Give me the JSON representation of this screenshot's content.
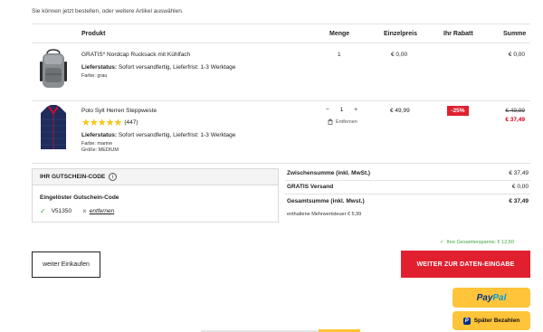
{
  "intro_text": "Sie können jetzt bestellen, oder weitere Artikel auswählen.",
  "table": {
    "headers": {
      "product": "Produkt",
      "quantity": "Menge",
      "unit_price": "Einzelpreis",
      "discount": "Ihr Rabatt",
      "sum": "Summe"
    }
  },
  "items": [
    {
      "name": "GRATIS* Nordcap Rucksack mit Kühlfach",
      "status_label": "Lieferstatus:",
      "status_value": "Sofort versandfertig, Lieferfrist: 1-3 Werktage",
      "color_line": "Farbe: grau",
      "quantity": "1",
      "unit_price": "€ 0,00",
      "sum": "€ 0,00"
    },
    {
      "name": "Polo Sylt Herren Steppweste",
      "rating_count": "(447)",
      "rating_stars": 5,
      "status_label": "Lieferstatus:",
      "status_value": "Sofort versandfertig, Lieferfrist: 1-3 Werktage",
      "color_line": "Farbe: marine",
      "size_line": "Größe: MEDIUM",
      "qty_minus": "−",
      "quantity": "1",
      "qty_plus": "+",
      "remove_label": "Entfernen",
      "unit_price": "€ 49,99",
      "discount": "-25%",
      "old_sum": "€ 49,99",
      "sum": "€ 37,49"
    }
  ],
  "coupon": {
    "header": "IHR GUTSCHEIN-CODE",
    "info_symbol": "i",
    "redeemed_label": "Eingelöster Gutschein-Code",
    "check_symbol": "✓",
    "code": "V51350",
    "remove_symbol": "×",
    "remove_label": "entfernen"
  },
  "totals": {
    "subtotal_label": "Zwischensumme (inkl. MwSt.)",
    "subtotal_value": "€ 37,49",
    "shipping_label": "GRATIS Versand",
    "shipping_value": "€ 0,00",
    "total_label": "Gesamtsumme (inkl. Mwst.)",
    "total_value": "€ 37,49",
    "vat_note": "enthaltene Mehrwertsteuer € 5,99"
  },
  "savings": {
    "check_symbol": "✓",
    "text": "Ihre Gesamtersparnis: € 12,50"
  },
  "buttons": {
    "continue_shopping": "weiter Einkaufen",
    "checkout": "WEITER ZUR DATEN-EINGABE",
    "paypal_part1": "Pay",
    "paypal_part2": "Pal",
    "paypal_later_icon_letter": "P",
    "paypal_later": "Später Bezahlen"
  },
  "colors": {
    "accent_red": "#e1202f",
    "paypal_yellow": "#ffc439",
    "success_green": "#3ea33e",
    "star_yellow": "#f5c518"
  }
}
